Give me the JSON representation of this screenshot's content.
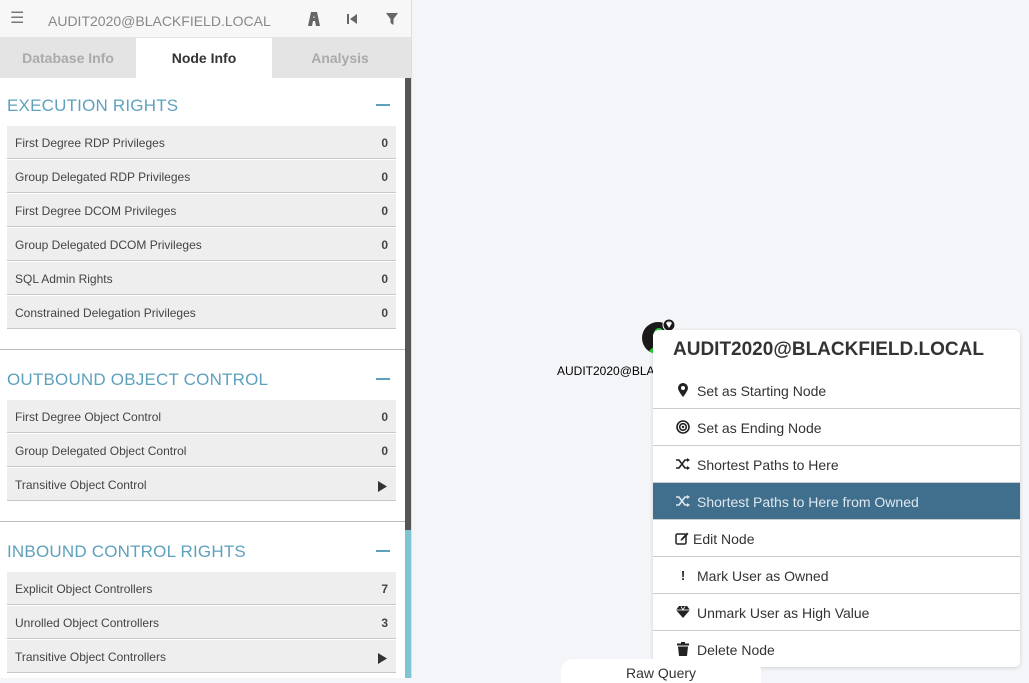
{
  "search": {
    "value": "AUDIT2020@BLACKFIELD.LOCAL"
  },
  "tabs": [
    {
      "label": "Database Info",
      "active": false
    },
    {
      "label": "Node Info",
      "active": true
    },
    {
      "label": "Analysis",
      "active": false
    }
  ],
  "sections": [
    {
      "title": "EXECUTION RIGHTS",
      "rows": [
        {
          "label": "First Degree RDP Privileges",
          "value": "0"
        },
        {
          "label": "Group Delegated RDP Privileges",
          "value": "0"
        },
        {
          "label": "First Degree DCOM Privileges",
          "value": "0"
        },
        {
          "label": "Group Delegated DCOM Privileges",
          "value": "0"
        },
        {
          "label": "SQL Admin Rights",
          "value": "0"
        },
        {
          "label": "Constrained Delegation Privileges",
          "value": "0"
        }
      ]
    },
    {
      "title": "OUTBOUND OBJECT CONTROL",
      "rows": [
        {
          "label": "First Degree Object Control",
          "value": "0"
        },
        {
          "label": "Group Delegated Object Control",
          "value": "0"
        },
        {
          "label": "Transitive Object Control",
          "value": null
        }
      ]
    },
    {
      "title": "INBOUND CONTROL RIGHTS",
      "rows": [
        {
          "label": "Explicit Object Controllers",
          "value": "7"
        },
        {
          "label": "Unrolled Object Controllers",
          "value": "3"
        },
        {
          "label": "Transitive Object Controllers",
          "value": null
        }
      ]
    }
  ],
  "graph": {
    "node_label": "AUDIT2020@BLACKFIELD.LOCAL"
  },
  "context_menu": {
    "title": "AUDIT2020@BLACKFIELD.LOCAL",
    "items": [
      {
        "label": "Set as Starting Node",
        "icon": "map-marker-icon"
      },
      {
        "label": "Set as Ending Node",
        "icon": "bullseye-icon"
      },
      {
        "label": "Shortest Paths to Here",
        "icon": "random-icon"
      },
      {
        "label": "Shortest Paths to Here from Owned",
        "icon": "random-icon",
        "highlighted": true
      },
      {
        "label": "Edit Node",
        "icon": "edit-icon"
      },
      {
        "label": "Mark User as Owned",
        "icon": "exclamation-icon"
      },
      {
        "label": "Unmark User as High Value",
        "icon": "gem-icon"
      },
      {
        "label": "Delete Node",
        "icon": "trash-icon"
      }
    ]
  },
  "raw_query": {
    "label": "Raw Query"
  },
  "colors": {
    "accent": "#5da1bd",
    "menu_highlight": "#406f8e",
    "node_fill": "#1a1a1a",
    "owned_badge": "#2ecc40"
  }
}
